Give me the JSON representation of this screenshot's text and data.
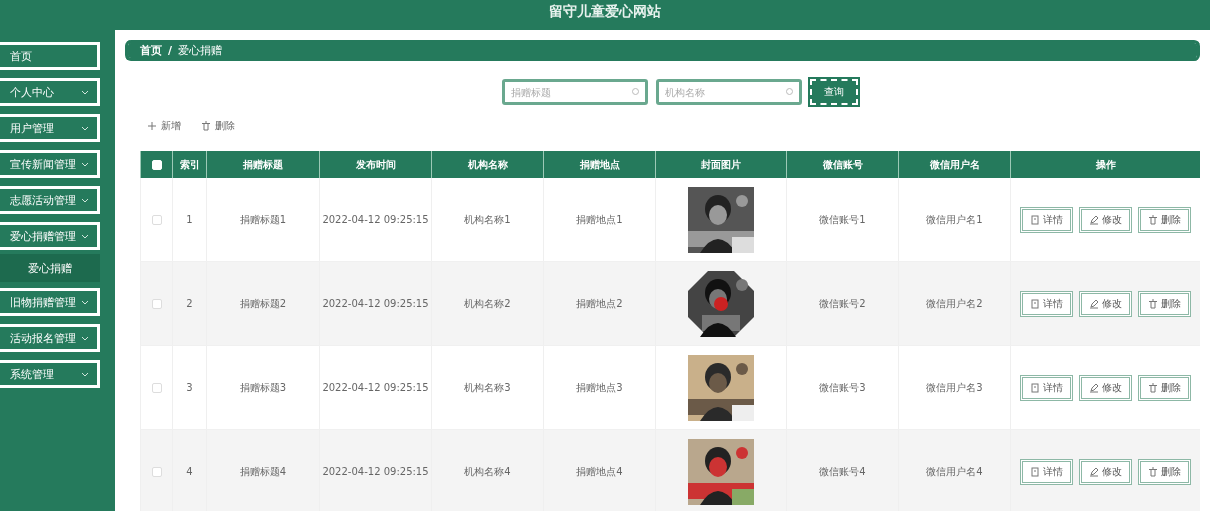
{
  "header": {
    "title": "留守儿童爱心网站"
  },
  "sidebar": {
    "items": [
      {
        "label": "首页",
        "expandable": false
      },
      {
        "label": "个人中心",
        "expandable": true
      },
      {
        "label": "用户管理",
        "expandable": true
      },
      {
        "label": "宣传新闻管理",
        "expandable": true
      },
      {
        "label": "志愿活动管理",
        "expandable": true
      },
      {
        "label": "爱心捐赠管理",
        "expandable": true,
        "children": [
          {
            "label": "爱心捐赠",
            "selected": true
          }
        ]
      },
      {
        "label": "旧物捐赠管理",
        "expandable": true
      },
      {
        "label": "活动报名管理",
        "expandable": true
      },
      {
        "label": "系统管理",
        "expandable": true
      }
    ]
  },
  "breadcrumb": [
    "首页",
    "爱心捐赠"
  ],
  "breadcrumb_separator": "/",
  "search": {
    "fields": [
      {
        "placeholder": "捐赠标题"
      },
      {
        "placeholder": "机构名称"
      }
    ],
    "button": "查询"
  },
  "actions": [
    {
      "kind": "add",
      "label": "新增"
    },
    {
      "kind": "delete",
      "label": "删除"
    }
  ],
  "table": {
    "header_checkbox": {
      "checked": false
    },
    "columns": [
      "索引",
      "捐赠标题",
      "发布时间",
      "机构名称",
      "捐赠地点",
      "封面图片",
      "微信账号",
      "微信用户名",
      "操作"
    ],
    "rows": [
      {
        "checked": false,
        "index": "1",
        "title": "捐赠标题1",
        "time": "2022-04-12 09:25:15",
        "org": "机构名称1",
        "place": "捐赠地点1",
        "cover": {
          "kind": "picture"
        },
        "wechat_account": "微信账号1",
        "wechat_name": "微信用户名1",
        "buttons": [
          {
            "kind": "detail",
            "label": "详情"
          },
          {
            "kind": "edit",
            "label": "修改"
          },
          {
            "kind": "delete",
            "label": "删除"
          }
        ]
      },
      {
        "checked": false,
        "index": "2",
        "title": "捐赠标题2",
        "time": "2022-04-12 09:25:15",
        "org": "机构名称2",
        "place": "捐赠地点2",
        "cover": {
          "kind": "picture"
        },
        "wechat_account": "微信账号2",
        "wechat_name": "微信用户名2",
        "buttons": [
          {
            "kind": "detail",
            "label": "详情"
          },
          {
            "kind": "edit",
            "label": "修改"
          },
          {
            "kind": "delete",
            "label": "删除"
          }
        ]
      },
      {
        "checked": false,
        "index": "3",
        "title": "捐赠标题3",
        "time": "2022-04-12 09:25:15",
        "org": "机构名称3",
        "place": "捐赠地点3",
        "cover": {
          "kind": "picture"
        },
        "wechat_account": "微信账号3",
        "wechat_name": "微信用户名3",
        "buttons": [
          {
            "kind": "detail",
            "label": "详情"
          },
          {
            "kind": "edit",
            "label": "修改"
          },
          {
            "kind": "delete",
            "label": "删除"
          }
        ]
      },
      {
        "checked": false,
        "index": "4",
        "title": "捐赠标题4",
        "time": "2022-04-12 09:25:15",
        "org": "机构名称4",
        "place": "捐赠地点4",
        "cover": {
          "kind": "picture"
        },
        "wechat_account": "微信账号4",
        "wechat_name": "微信用户名4",
        "buttons": [
          {
            "kind": "detail",
            "label": "详情"
          },
          {
            "kind": "edit",
            "label": "修改"
          },
          {
            "kind": "delete",
            "label": "删除"
          }
        ]
      }
    ]
  }
}
